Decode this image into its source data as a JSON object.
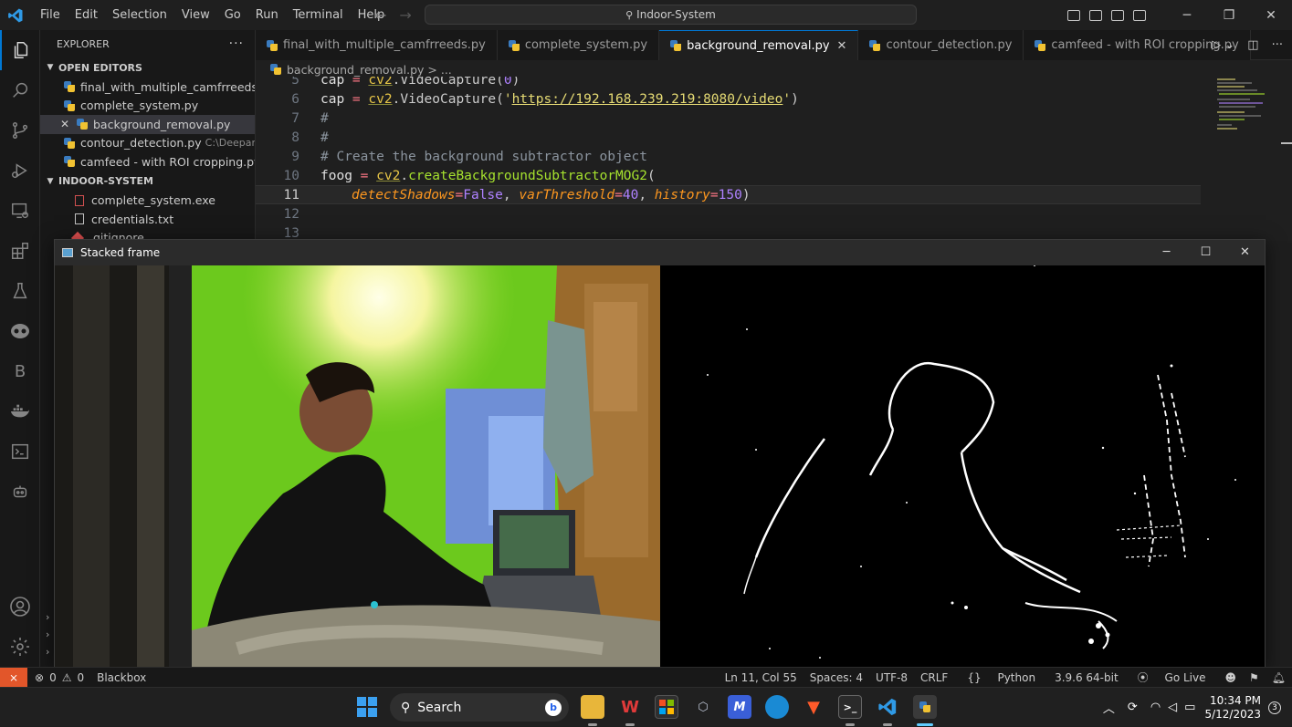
{
  "window": {
    "menu": [
      "File",
      "Edit",
      "Selection",
      "View",
      "Go",
      "Run",
      "Terminal",
      "Help"
    ],
    "search_text": "Indoor-System"
  },
  "sidebar": {
    "explorer_title": "EXPLORER",
    "open_editors_title": "OPEN EDITORS",
    "open_editors": [
      {
        "name": "final_with_multiple_camfrreeds....",
        "path": ""
      },
      {
        "name": "complete_system.py",
        "path": ""
      },
      {
        "name": "background_removal.py",
        "path": ""
      },
      {
        "name": "contour_detection.py",
        "path": "C:\\Deepan..."
      },
      {
        "name": "camfeed - with ROI cropping.py...",
        "path": ""
      }
    ],
    "project_title": "INDOOR-SYSTEM",
    "project_files": [
      "complete_system.exe",
      "credentials.txt",
      ".gitignore"
    ]
  },
  "tabs": [
    {
      "label": "final_with_multiple_camfrreeds.py"
    },
    {
      "label": "complete_system.py"
    },
    {
      "label": "background_removal.py"
    },
    {
      "label": "contour_detection.py"
    },
    {
      "label": "camfeed - with ROI cropping.py"
    }
  ],
  "breadcrumb": {
    "file": "background_removal.py",
    "rest": "> ..."
  },
  "editor": {
    "line_numbers": [
      "5",
      "6",
      "7",
      "8",
      "9",
      "10",
      "11",
      "12",
      "13"
    ],
    "l5": {
      "var": "cap",
      "eq": " = ",
      "mod": "cv2",
      "rest": ".VideoCapture(",
      "num": "0",
      "close": ")"
    },
    "l6": {
      "var": "cap",
      "eq": " = ",
      "mod": "cv2",
      "rest": ".VideoCapture(",
      "q1": "'",
      "url": "https://192.168.239.219:8080/video",
      "q2": "'",
      "close": ")"
    },
    "l7": "#",
    "l8": "#",
    "l9": "# Create the background subtractor object",
    "l10": {
      "var": "foog",
      "eq": " = ",
      "mod": "cv2",
      "dot": ".",
      "fn": "createBackgroundSubtractorMOG2",
      "open": "("
    },
    "l11": {
      "p1": "detectShadows",
      "v1": "False",
      "p2": "varThreshold",
      "v2": "40",
      "p3": "history",
      "v3": "150"
    }
  },
  "cv_window": {
    "title": "Stacked frame"
  },
  "statusbar": {
    "errors": "0",
    "warnings": "0",
    "blackbox": "Blackbox",
    "position": "Ln 11, Col 55",
    "spaces": "Spaces: 4",
    "encoding": "UTF-8",
    "eol": "CRLF",
    "language": "Python",
    "interpreter": "3.9.6 64-bit",
    "golive": "Go Live"
  },
  "taskbar": {
    "search_label": "Search",
    "time": "10:34 PM",
    "date": "5/12/2023",
    "notifications": "3"
  },
  "colors": {
    "accent": "#0078d4",
    "remote": "#e2562a",
    "green_wall": "#6fcf1c"
  }
}
